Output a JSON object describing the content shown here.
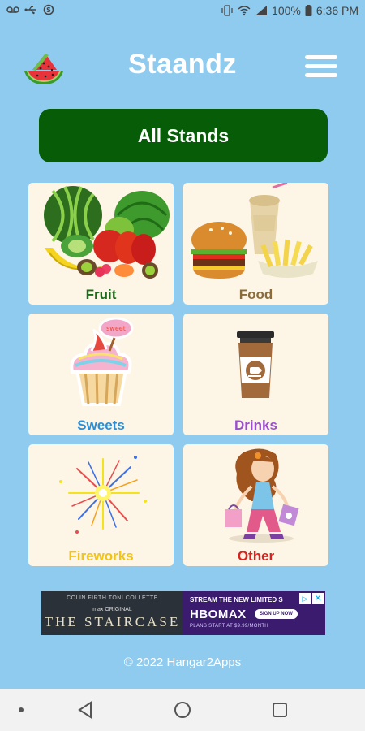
{
  "status_bar": {
    "battery": "100%",
    "time": "6:36 PM"
  },
  "header": {
    "title": "Staandz",
    "logo_icon": "watermelon-icon",
    "menu_icon": "hamburger-menu-icon"
  },
  "all_stands_button": {
    "label": "All Stands",
    "color": "#075c07"
  },
  "categories": [
    {
      "label": "Fruit",
      "color": "#1b6b1b",
      "icon": "fruit-basket-icon"
    },
    {
      "label": "Food",
      "color": "#8a6d3b",
      "icon": "burger-fries-icon"
    },
    {
      "label": "Sweets",
      "color": "#2a8fd6",
      "icon": "cupcake-icon"
    },
    {
      "label": "Drinks",
      "color": "#9b4fd0",
      "icon": "coffee-cup-icon"
    },
    {
      "label": "Fireworks",
      "color": "#f2c418",
      "icon": "sparkler-icon"
    },
    {
      "label": "Other",
      "color": "#e0201c",
      "icon": "shopping-girl-icon"
    }
  ],
  "ad": {
    "cast": "COLIN FIRTH    TONI COLLETTE",
    "brand_tag": "max ORIGINAL",
    "title": "THE STAIRCASE",
    "stream_text": "STREAM THE NEW LIMITED S",
    "network": "HBOMAX",
    "cta": "SIGN UP NOW",
    "plans": "PLANS START AT $9.99/MONTH"
  },
  "footer": {
    "copyright": "© 2022 Hangar2Apps"
  },
  "colors": {
    "background": "#8ecbef",
    "card_background": "#fdf5e6"
  }
}
